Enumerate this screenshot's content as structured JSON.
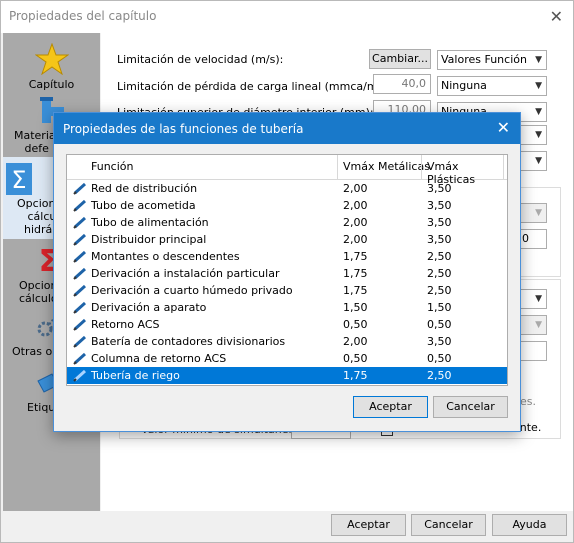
{
  "window": {
    "title": "Propiedades del capítulo",
    "close": "✕"
  },
  "sidebar": {
    "items": [
      {
        "label": "Capítulo",
        "icon": "star-icon"
      },
      {
        "label": "Materiales por defecto",
        "icon": "pipe-icon",
        "label_visible": "Materia\ndefe"
      },
      {
        "label": "Opciones de cálculo hidráulico",
        "icon": "sigma-icon",
        "label_visible": "Opcion\ncálculo\nhidrá"
      },
      {
        "label": "Opciones de cálculo",
        "icon": "sigma-red-icon",
        "label_visible": "Opcion\ncálculo f"
      },
      {
        "label": "Otras opciones",
        "icon": "gears-icon",
        "label_visible": "Otras op"
      },
      {
        "label": "Etiquetas",
        "icon": "label-icon",
        "label_visible": "Etiqu"
      }
    ]
  },
  "main": {
    "vel_label": "Limitación de velocidad (m/s):",
    "vel_button": "Cambiar...",
    "vel_select": "Valores Función",
    "loss_label": "Limitación de pérdida de carga lineal (mmca/m):",
    "loss_value": "40,0",
    "loss_select": "Ninguna",
    "diam_label": "Limitación superior de diámetro interior (mm):",
    "diam_value": "110,00",
    "diam_select": "Ninguna",
    "frag_value": "0",
    "frag_bottom_left": "Valor mínimo de simultaneidad:",
    "frag_bottom_right": "ente.",
    "frag_es": "es."
  },
  "modal": {
    "title": "Propiedades de las funciones de tubería",
    "close": "✕",
    "columns": [
      "Función",
      "Vmáx Metálicas",
      "Vmáx Plásticas"
    ],
    "rows": [
      {
        "funcion": "Red de distribución",
        "met": "2,00",
        "pla": "3,50"
      },
      {
        "funcion": "Tubo de acometida",
        "met": "2,00",
        "pla": "3,50"
      },
      {
        "funcion": "Tubo de alimentación",
        "met": "2,00",
        "pla": "3,50"
      },
      {
        "funcion": "Distribuidor principal",
        "met": "2,00",
        "pla": "3,50"
      },
      {
        "funcion": "Montantes o descendentes",
        "met": "1,75",
        "pla": "2,50"
      },
      {
        "funcion": "Derivación a instalación particular",
        "met": "1,75",
        "pla": "2,50"
      },
      {
        "funcion": "Derivación a cuarto húmedo privado",
        "met": "1,75",
        "pla": "2,50"
      },
      {
        "funcion": "Derivación a aparato",
        "met": "1,50",
        "pla": "1,50"
      },
      {
        "funcion": "Retorno ACS",
        "met": "0,50",
        "pla": "0,50"
      },
      {
        "funcion": "Batería de contadores divisionarios",
        "met": "2,00",
        "pla": "3,50"
      },
      {
        "funcion": "Columna de retorno ACS",
        "met": "0,50",
        "pla": "0,50"
      },
      {
        "funcion": "Tubería de riego",
        "met": "1,75",
        "pla": "2,50"
      }
    ],
    "accept": "Aceptar",
    "cancel": "Cancelar"
  },
  "footer": {
    "accept": "Aceptar",
    "cancel": "Cancelar",
    "help": "Ayuda"
  }
}
